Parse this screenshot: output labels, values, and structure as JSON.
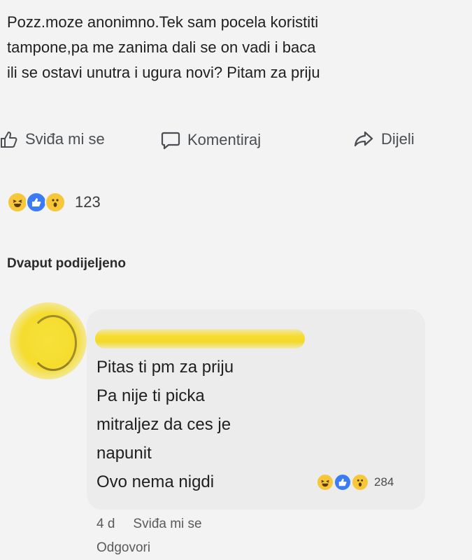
{
  "post": {
    "text": "Pozz.moze anonimno.Tek sam pocela koristiti\ntampone,pa me zanima dali se on vadi i baca\nili se ostavi unutra i ugura novi? Pitam za priju"
  },
  "actions": {
    "like_label": "Sviđa mi se",
    "comment_label": "Komentiraj",
    "share_label": "Dijeli"
  },
  "reactions": {
    "icons": [
      "haha-icon",
      "like-icon",
      "wow-icon"
    ],
    "count": "123"
  },
  "shares": {
    "label": "Dvaput podijeljeno"
  },
  "comment": {
    "author": "",
    "text": "Pitas ti pm za priju\nPa nije ti picka\nmitraljez da ces je\nnapunit\nOvo nema nigdi",
    "reaction_count": "284",
    "time": "4 d",
    "like_label": "Sviđa mi se",
    "reply_label": "Odgovori"
  },
  "colors": {
    "background": "#f3f3f3",
    "bubble": "#ececec",
    "redaction_yellow": "#f6de2e",
    "like_blue": "#3b7bf3",
    "reaction_yellow": "#f7c73a"
  }
}
